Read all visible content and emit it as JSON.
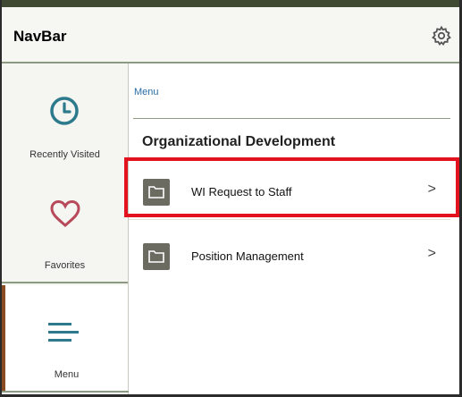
{
  "header": {
    "title": "NavBar",
    "settings_icon": "gear-icon"
  },
  "sidebar": {
    "items": [
      {
        "label": "Recently Visited",
        "icon": "clock-icon"
      },
      {
        "label": "Favorites",
        "icon": "heart-icon"
      },
      {
        "label": "Menu",
        "icon": "menu-icon",
        "selected": true
      }
    ]
  },
  "main": {
    "breadcrumb": "Menu",
    "section_title": "Organizational Development",
    "rows": [
      {
        "label": "WI Request to Staff",
        "icon": "folder-icon",
        "chevron": ">",
        "highlighted": true
      },
      {
        "label": "Position Management",
        "icon": "folder-icon",
        "chevron": ">"
      }
    ]
  },
  "colors": {
    "accent_teal": "#2c7a8c",
    "heart_red": "#b8495a",
    "link_blue": "#2a6ea8",
    "highlight_red": "#e2131e",
    "header_band": "#404a32"
  }
}
